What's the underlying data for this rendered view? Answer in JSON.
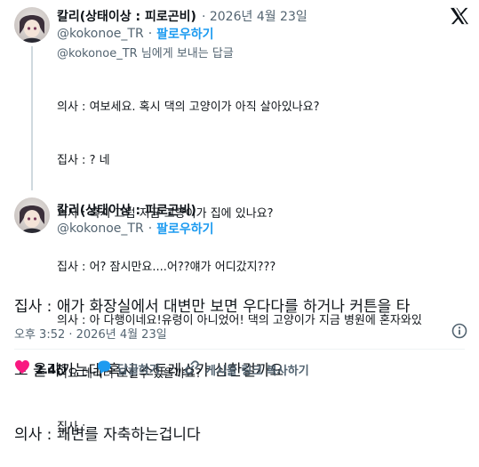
{
  "reply_tweet": {
    "name": "칼리(상태이상 : 피로곤비)",
    "date": "· 2026년 4월 23일",
    "handle": "@kokonoe_TR",
    "follow_sep": "·",
    "follow": "팔로우하기",
    "reply_to": "@kokonoe_TR 님에게 보내는 답글",
    "lines": [
      "의사 : 여보세요. 혹시 댁의 고양이가 아직 살아있나요?",
      "집사 : ? 네",
      "의사 : 혹시 그럼 지금 고양이가 집에 있나요?",
      "집사 : 어? 잠시만요....어??얘가 어디갔지???",
      "의사 : 아 다행이네요!유령이 아니었어! 댁의 고양이가 지금 병원에 혼자와있",
      "어요 데리러 오실수 있을까요?",
      "집사 :"
    ]
  },
  "main_tweet": {
    "name": "칼리(상태이상 : 피로곤비)",
    "handle": "@kokonoe_TR",
    "follow_sep": "·",
    "follow": "팔로우하기",
    "lines": [
      "집사 : 애가 화장실에서 대변만 보면 우다다를 하거나 커튼을 타",
      "고 올라가는데 혹시 스트레스가 심한걸까요",
      "의사 : 쾌변를 자축하는겁니다"
    ],
    "timestamp": "오후 3:52 · 2026년 4월 23일",
    "actions": {
      "like_count": "2.4천",
      "reply_label": "답글하기",
      "copy_link_label": "게시물 링크 복사하기"
    }
  },
  "icons": {
    "logo": "x-logo-icon",
    "info": "info-icon",
    "like": "heart-icon",
    "reply": "reply-bubble-icon",
    "link": "link-icon"
  },
  "colors": {
    "text": "#0f1419",
    "muted": "#536471",
    "accent": "#1d9bf0",
    "like": "#f91880"
  }
}
